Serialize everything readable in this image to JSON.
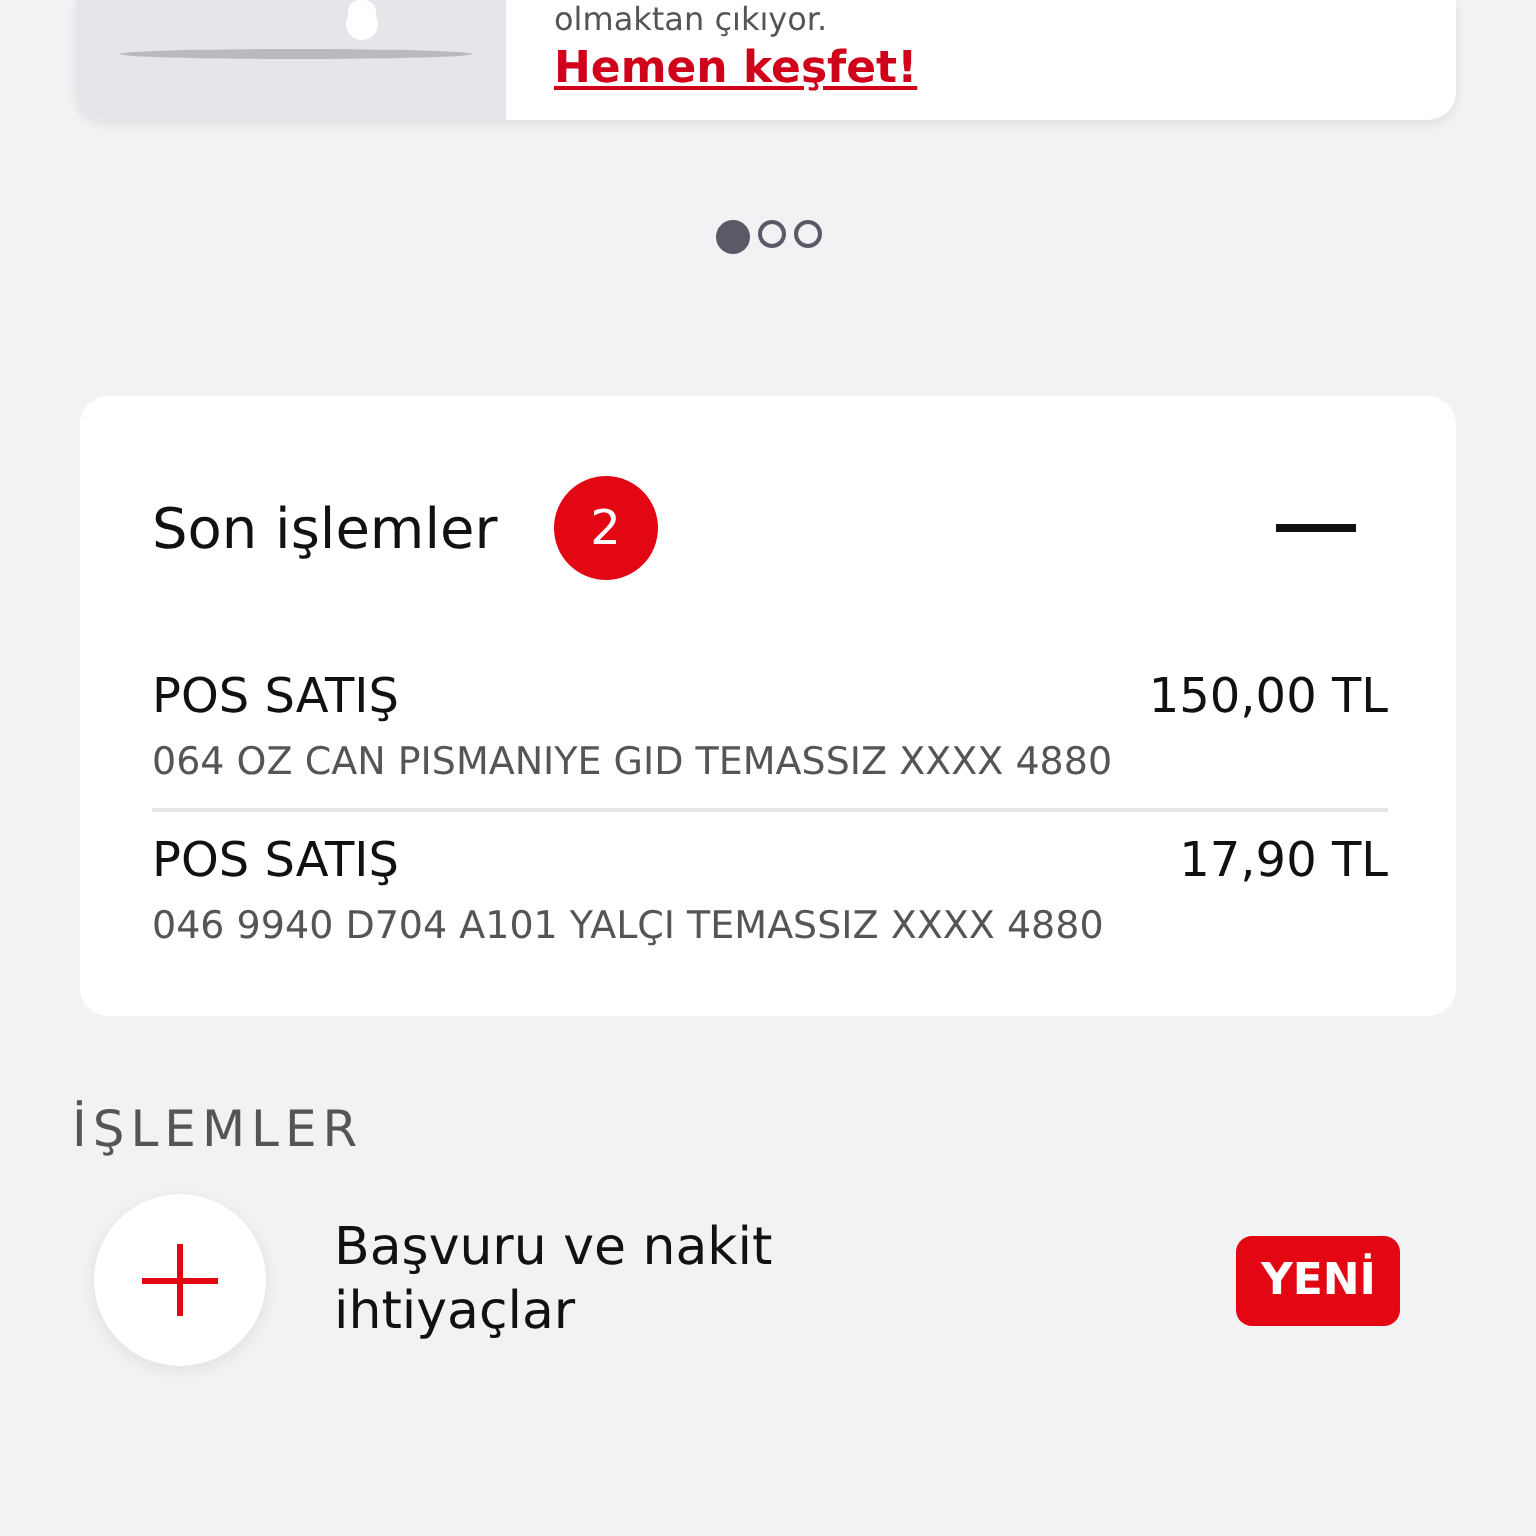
{
  "promo": {
    "text": "olmaktan çıkıyor.",
    "link": "Hemen keşfet!"
  },
  "carousel": {
    "dots": [
      {
        "selected": true
      },
      {
        "selected": false
      },
      {
        "selected": false
      }
    ]
  },
  "recent": {
    "title": "Son işlemler",
    "count": "2",
    "expanded": true,
    "rows": [
      {
        "type": "POS SATIŞ",
        "amount": "150,00 TL",
        "detail": "064 OZ CAN PISMANIYE GID TEMASSIZ XXXX 4880"
      },
      {
        "type": "POS SATIŞ",
        "amount": "17,90 TL",
        "detail": "046 9940 D704 A101 YALÇI TEMASSIZ XXXX 4880"
      }
    ]
  },
  "operations": {
    "title": "İŞLEMLER",
    "items": [
      {
        "label": "Başvuru ve nakit ihtiyaçlar",
        "badge": "YENİ"
      }
    ]
  }
}
